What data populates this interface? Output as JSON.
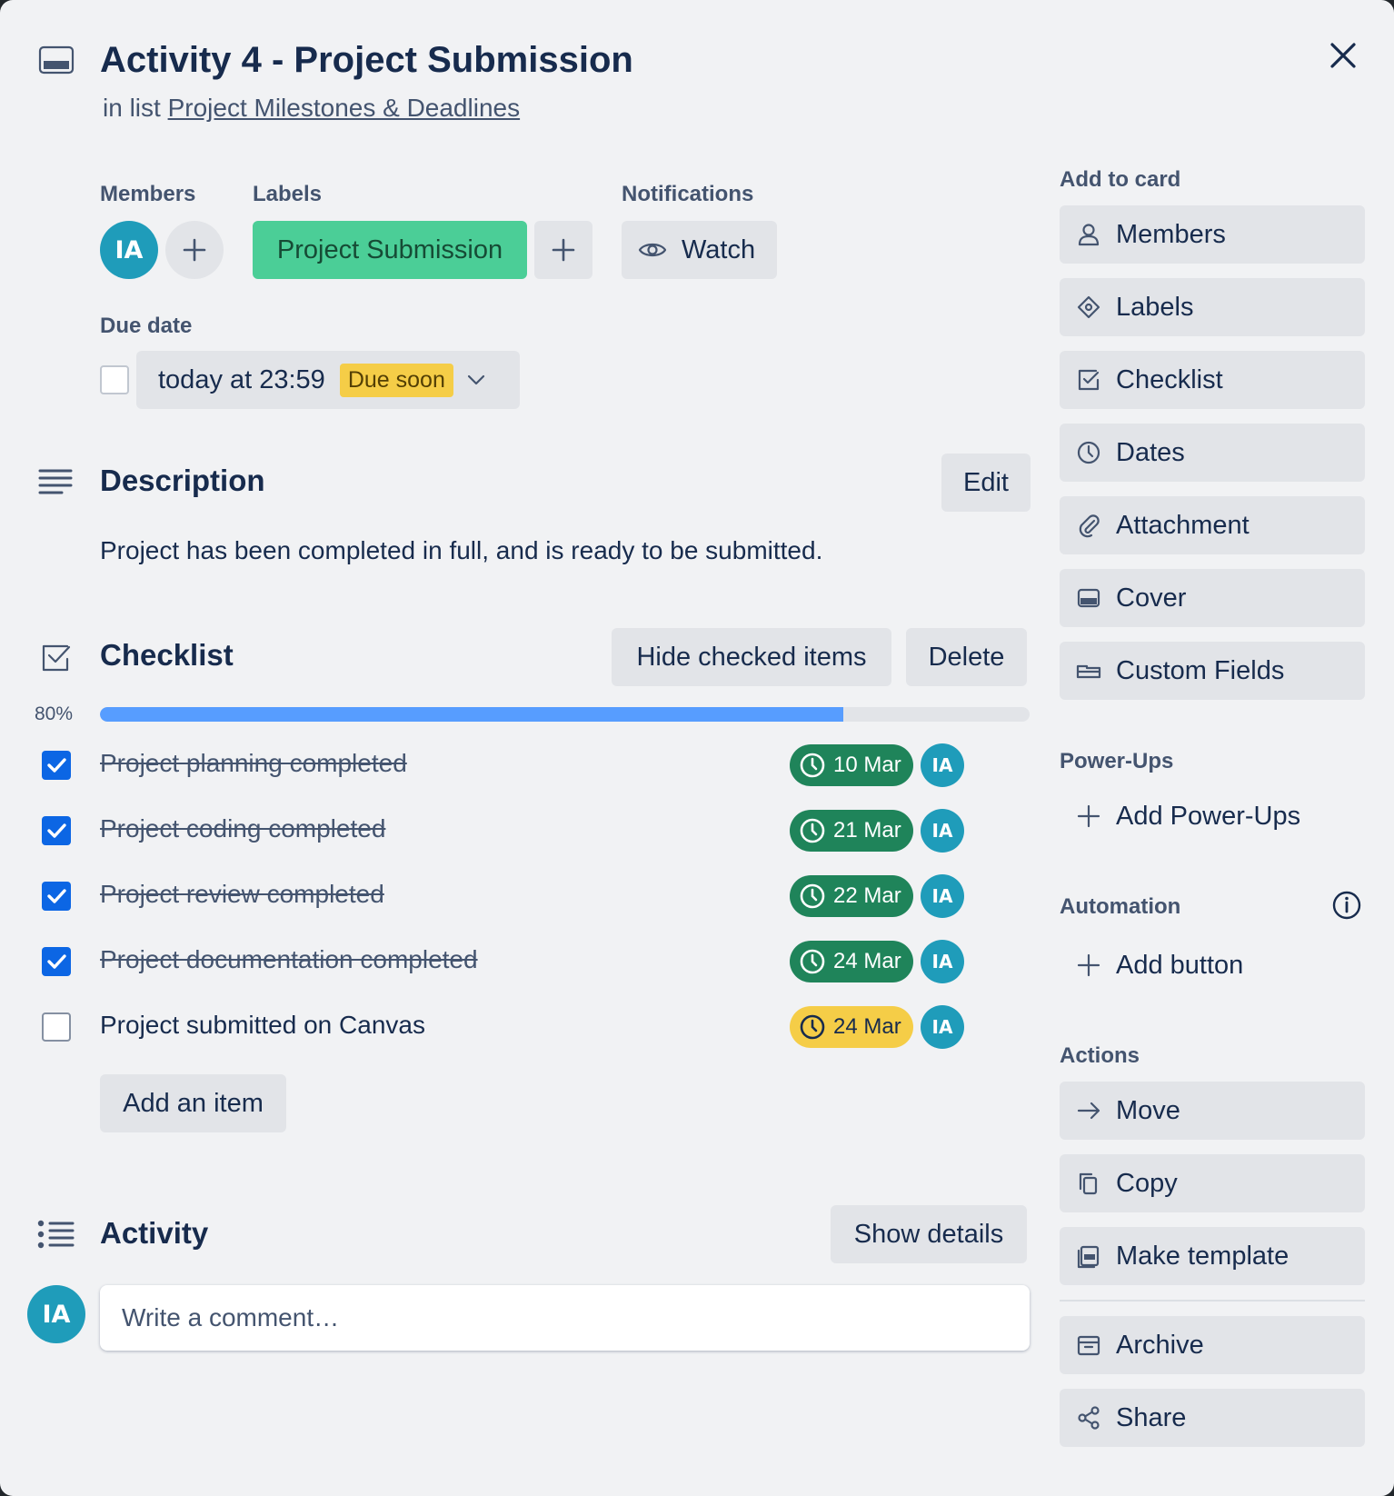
{
  "card": {
    "title": "Activity 4 - Project Submission",
    "list_prefix": "in list",
    "list_name": "Project Milestones & Deadlines"
  },
  "members": {
    "label": "Members",
    "avatars": [
      "IA"
    ]
  },
  "labels": {
    "label": "Labels",
    "items": [
      {
        "text": "Project Submission",
        "color": "#4bce97"
      }
    ]
  },
  "notifications": {
    "label": "Notifications",
    "watch_label": "Watch"
  },
  "due": {
    "label": "Due date",
    "value": "today at 23:59",
    "badge": "Due soon",
    "badge_color": "#f5cd47"
  },
  "description": {
    "title": "Description",
    "edit_label": "Edit",
    "text": "Project has been completed in full, and is ready to be submitted."
  },
  "checklist": {
    "title": "Checklist",
    "hide_label": "Hide checked items",
    "delete_label": "Delete",
    "progress_text": "80%",
    "progress_fraction": 0.8,
    "add_item_label": "Add an item",
    "items": [
      {
        "text": "Project planning completed",
        "checked": true,
        "date": "10 Mar",
        "date_status": "complete",
        "assignee": "IA"
      },
      {
        "text": "Project coding completed",
        "checked": true,
        "date": "21 Mar",
        "date_status": "complete",
        "assignee": "IA"
      },
      {
        "text": "Project review completed",
        "checked": true,
        "date": "22 Mar",
        "date_status": "complete",
        "assignee": "IA"
      },
      {
        "text": "Project documentation completed",
        "checked": true,
        "date": "24 Mar",
        "date_status": "complete",
        "assignee": "IA"
      },
      {
        "text": "Project submitted on Canvas",
        "checked": false,
        "date": "24 Mar",
        "date_status": "due-soon",
        "assignee": "IA"
      }
    ]
  },
  "activity": {
    "title": "Activity",
    "show_details_label": "Show details",
    "comment_placeholder": "Write a comment…",
    "user_avatar": "IA"
  },
  "sidebar": {
    "add_to_card_label": "Add to card",
    "add_to_card": [
      {
        "label": "Members",
        "icon": "person-icon"
      },
      {
        "label": "Labels",
        "icon": "tag-icon"
      },
      {
        "label": "Checklist",
        "icon": "checklist-icon"
      },
      {
        "label": "Dates",
        "icon": "clock-icon"
      },
      {
        "label": "Attachment",
        "icon": "paperclip-icon"
      },
      {
        "label": "Cover",
        "icon": "cover-icon"
      },
      {
        "label": "Custom Fields",
        "icon": "custom-fields-icon"
      }
    ],
    "power_ups_label": "Power-Ups",
    "add_power_ups": "Add Power-Ups",
    "automation_label": "Automation",
    "add_button": "Add button",
    "actions_label": "Actions",
    "actions": [
      {
        "label": "Move",
        "icon": "arrow-right-icon"
      },
      {
        "label": "Copy",
        "icon": "copy-icon"
      },
      {
        "label": "Make template",
        "icon": "template-icon"
      },
      {
        "label": "Archive",
        "icon": "archive-icon"
      },
      {
        "label": "Share",
        "icon": "share-icon"
      }
    ]
  },
  "colors": {
    "accent_blue": "#0c66e4",
    "progress_blue": "#579dff",
    "date_complete": "#1f845a",
    "avatar": "#1f9cba"
  }
}
